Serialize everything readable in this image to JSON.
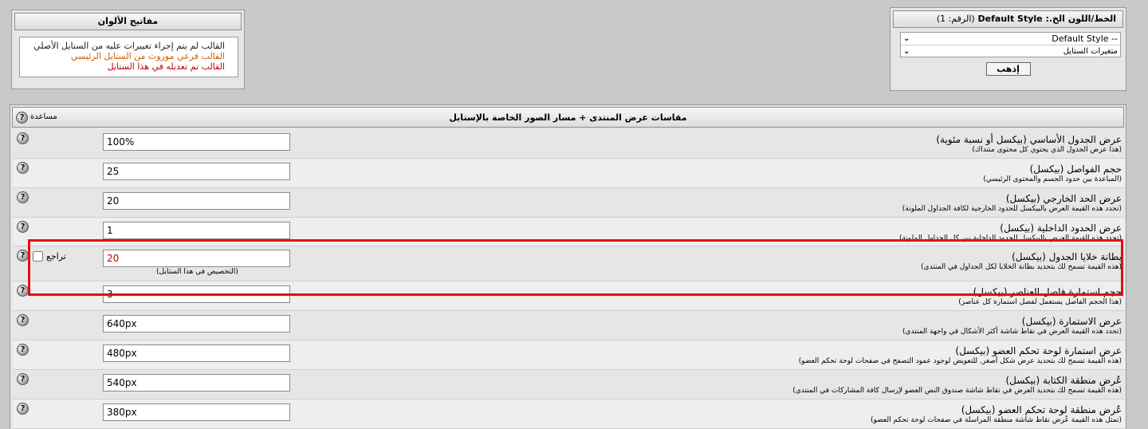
{
  "color_keys": {
    "title": "مفاتيح الألوان",
    "items": [
      {
        "label": "القالب لم يتم إجراء تغييرات عليه من الستايل الأصلي",
        "color": "#222222"
      },
      {
        "label": "القالب فرعي موروث من الستايل الرئيسي",
        "color": "#d06000"
      },
      {
        "label": "القالب تم تعديله في هذا الستايل",
        "color": "#c00000"
      }
    ]
  },
  "style_selector": {
    "title": "الخط/اللون الخ.: Default Style",
    "number": "(الرقم: 1)",
    "options": [
      "-- Default Style",
      "متغيرات الستايل"
    ],
    "go_label": "إذهب"
  },
  "main": {
    "title": "مقاسات عرض المنتدى + مسار الصور الخاصة بالإستايل",
    "help_label": "مساعدة",
    "revert_label": "تراجع",
    "custom_note": "(التخصيص في هذا الستايل)",
    "rows": [
      {
        "title": "عرض الجدول الأساسي (بيكسل أو نسبة مئوية)",
        "sub": "(هذا عرض الجدول الذي يحتوي كل محتوى منتداك)",
        "value": "100%"
      },
      {
        "title": "حجم الفواصل (بيكسل)",
        "sub": "(المباعدة بين حدود الجسم والمحتوى الرئيسي)",
        "value": "25"
      },
      {
        "title": "عرض الحد الخارجي (بيكسل)",
        "sub": "(تحدد هذه القيمة العرض بالبيكسل للحدود الخارجية لكافة الجداول الملونة)",
        "value": "20"
      },
      {
        "title": "عرض الحدود الداخلية (بيكسل)",
        "sub": "(تحدد هذه القيمة العرض بالبيكسل للحدود الداخلية بين كل الجداول الملونة)",
        "value": "1"
      },
      {
        "title": "بطانة خلايا الجدول (بيكسل)",
        "sub": "(هذه القيمة تسمح لك بتحديد بطانة الخلايا لكل الجداول في المنتدى)",
        "value": "20"
      },
      {
        "title": "حجم استمارة فاصل العناصر (بيكسل)",
        "sub": "(هذا الحجم الفاصل يستعمل لفصل استمارة كل عناصر)",
        "value": "3"
      },
      {
        "title": "عرض الاستمارة (بيكسل)",
        "sub": "(تحدد هذه القيمة العرض في نقاط شاشة أكثر الأشكال في واجهة المنتدى)",
        "value": "640px"
      },
      {
        "title": "عرض استمارة لوحة تحكم العضو (بيكسل)",
        "sub": "(هذه القيمة تسمح لك بتحديد عرض شكل أصغر, للتعويض لوجود عمود التصفح في صفحات لوحة تحكم العضو)",
        "value": "480px"
      },
      {
        "title": "عُرض منطقة الكتابة (بيكسل)",
        "sub": "(هذه القيمة تسمح لك بتحديد العرض في نقاط شاشة صندوق النص العضو لإرسال كافة المشاركات في المنتدى)",
        "value": "540px"
      },
      {
        "title": "عُرض منطقة لوحة تحكم العضو (بيكسل)",
        "sub": "(تمثل هذه القيمة عُرض نقاط شاشة منطقة المراسلة في صفحات لوحة تحكم العضو)",
        "value": "380px"
      }
    ]
  }
}
